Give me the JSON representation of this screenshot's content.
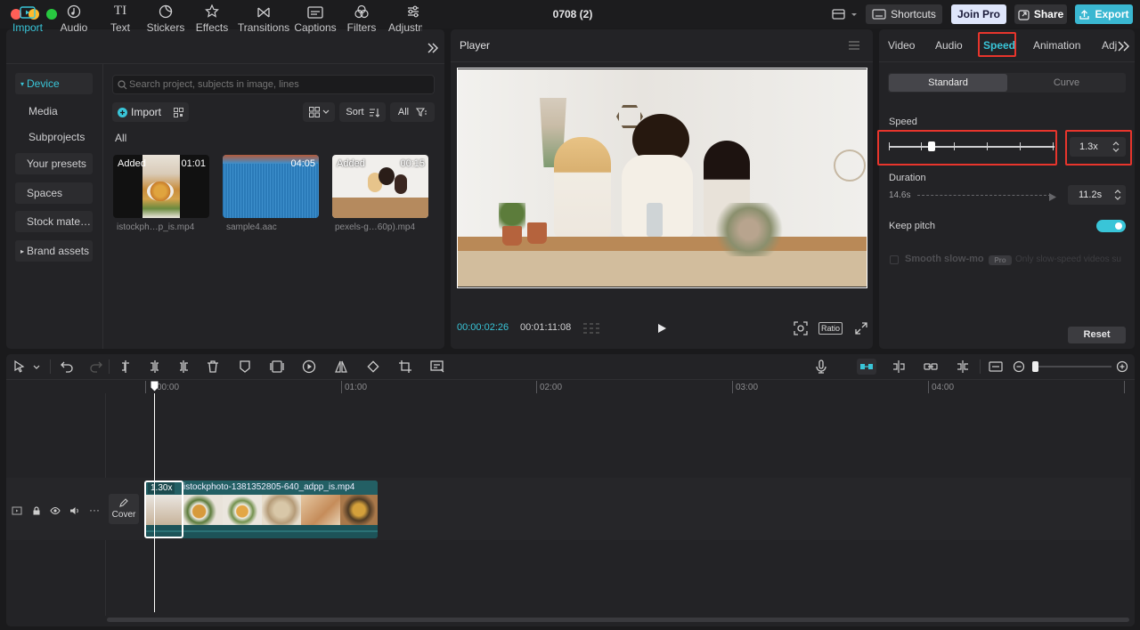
{
  "window": {
    "title": "0708 (2)"
  },
  "titlebar": {
    "shortcuts": "Shortcuts",
    "join_pro": "Join Pro",
    "share": "Share",
    "export": "Export"
  },
  "media_tabs": [
    {
      "label": "Import",
      "icon": "import-icon",
      "active": true
    },
    {
      "label": "Audio",
      "icon": "audio-icon"
    },
    {
      "label": "Text",
      "icon": "text-icon"
    },
    {
      "label": "Stickers",
      "icon": "stickers-icon"
    },
    {
      "label": "Effects",
      "icon": "effects-icon"
    },
    {
      "label": "Transitions",
      "icon": "transitions-icon"
    },
    {
      "label": "Captions",
      "icon": "captions-icon"
    },
    {
      "label": "Filters",
      "icon": "filters-icon"
    },
    {
      "label": "Adjustm",
      "icon": "adjust-icon"
    }
  ],
  "sidebar": {
    "items": [
      "Device",
      "Media",
      "Subprojects",
      "Your presets",
      "Spaces",
      "Stock mate…",
      "Brand assets"
    ]
  },
  "search": {
    "placeholder": "Search project, subjects in image, lines"
  },
  "media_toolbar": {
    "import": "Import",
    "sort": "Sort",
    "all": "All",
    "section": "All"
  },
  "media": [
    {
      "name": "istockph…p_is.mp4",
      "badge": "Added",
      "duration": "01:01"
    },
    {
      "name": "sample4.aac",
      "badge": "",
      "duration": "04:05"
    },
    {
      "name": "pexels-g…60p).mp4",
      "badge": "Added",
      "duration": "00:15"
    }
  ],
  "player": {
    "title": "Player",
    "current_time": "00:00:02:26",
    "total_time": "00:01:11:08",
    "ratio": "Ratio"
  },
  "inspector": {
    "tabs": [
      "Video",
      "Audio",
      "Speed",
      "Animation",
      "Adjust"
    ],
    "active_tab": "Speed",
    "modes": [
      "Standard",
      "Curve"
    ],
    "speed_label": "Speed",
    "speed_value": "1.3x",
    "speed_fraction": 0.26,
    "duration_label": "Duration",
    "duration_orig": "14.6s",
    "duration_new": "11.2s",
    "keep_pitch": "Keep pitch",
    "smooth_slowmo": "Smooth slow-mo",
    "pro": "Pro",
    "smooth_desc": "Only slow-speed videos su",
    "reset": "Reset"
  },
  "timeline": {
    "ruler": [
      "00:00",
      "01:00",
      "02:00",
      "03:00",
      "04:00"
    ],
    "clip_speed": "1.30x",
    "clip_name": "istockphoto-1381352805-640_adpp_is.mp4",
    "cover": "Cover"
  },
  "colors": {
    "accent": "#39c5d8",
    "highlight": "#e8352c",
    "export": "#3ab7d1",
    "join_pro": "#dfe6fb"
  }
}
